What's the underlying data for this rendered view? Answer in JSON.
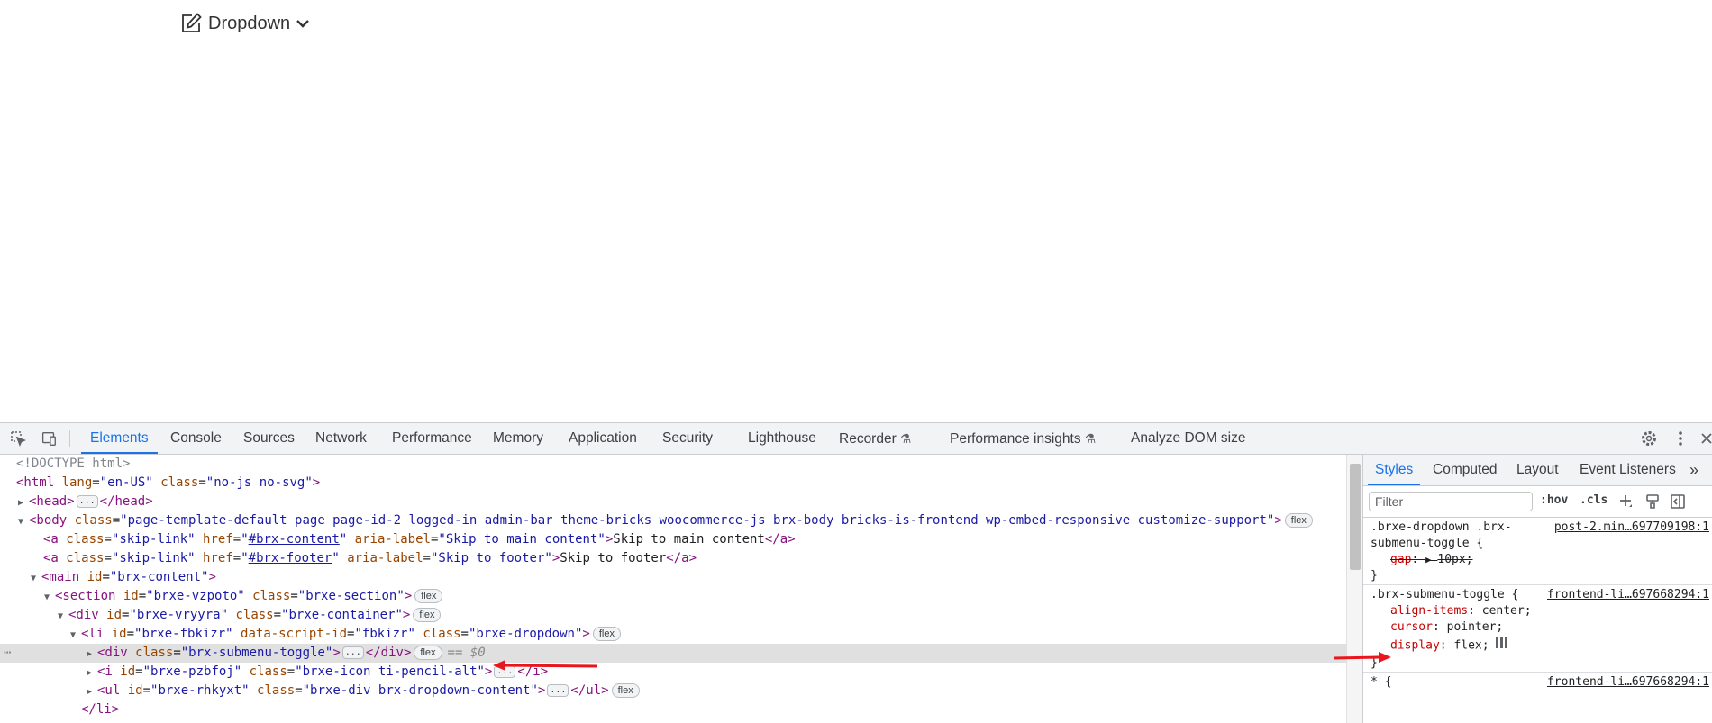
{
  "page": {
    "dropdown_label": "Dropdown"
  },
  "devtools": {
    "tabs": [
      "Elements",
      "Console",
      "Sources",
      "Network",
      "Performance",
      "Memory",
      "Application",
      "Security",
      "Lighthouse",
      "Recorder",
      "Performance insights",
      "Analyze DOM size"
    ],
    "active_tab": "Elements",
    "elements": {
      "selected_marker": "== $0",
      "ellipsis": "...",
      "nodes": {
        "doctype": "<!DOCTYPE html>",
        "html_tag": "<html ",
        "html_lang_attr": "lang",
        "html_lang_val": "\"en-US\"",
        "html_class_attr": "class",
        "html_class_val": "\"no-js no-svg\"",
        "head_open": "<head>",
        "head_close": "</head>",
        "body_tag": "<body ",
        "body_class_attr": "class",
        "body_class_val": "\"page-template-default page page-id-2 logged-in admin-bar theme-bricks woocommerce-js brx-body bricks-is-frontend wp-embed-responsive customize-support\"",
        "a_tag": "<a ",
        "a_close": "</a>",
        "class_attr": "class",
        "href_attr": "href",
        "aria_attr": "aria-label",
        "skip_link_class": "\"skip-link\"",
        "link1_href": "#brx-content",
        "link1_aria": "\"Skip to main content\"",
        "link1_text": "Skip to main content",
        "link2_href": "#brx-footer",
        "link2_aria": "\"Skip to footer\"",
        "link2_text": "Skip to footer",
        "main_tag": "<main ",
        "id_attr": "id",
        "main_id": "\"brx-content\"",
        "section_tag": "<section ",
        "section_id": "\"brxe-vzpoto\"",
        "section_class": "\"brxe-section\"",
        "div_tag": "<div ",
        "div_id": "\"brxe-vryyra\"",
        "div_class": "\"brxe-container\"",
        "li_tag": "<li ",
        "li_id": "\"brxe-fbkizr\"",
        "data_script_attr": "data-script-id",
        "li_script_id": "\"fbkizr\"",
        "li_class": "\"brxe-dropdown\"",
        "toggle_class": "\"brx-submenu-toggle\"",
        "div_close": "</div>",
        "i_tag": "<i ",
        "i_id": "\"brxe-pzbfoj\"",
        "i_class": "\"brxe-icon ti-pencil-alt\"",
        "i_close": "</i>",
        "ul_tag": "<ul ",
        "ul_id": "\"brxe-rhkyxt\"",
        "ul_class": "\"brxe-div brx-dropdown-content\"",
        "ul_close": "</ul>",
        "li_close": "</li>",
        "gt": ">",
        "eq": "="
      },
      "flex_badge": "flex"
    },
    "styles": {
      "tabs": [
        "Styles",
        "Computed",
        "Layout",
        "Event Listeners"
      ],
      "active_tab": "Styles",
      "filter_placeholder": "Filter",
      "hov_label": ":hov",
      "cls_label": ".cls",
      "rules": [
        {
          "selector": ".brxe-dropdown .brx-submenu-toggle {",
          "source": "post-2.min…697709198:1",
          "declarations": [
            {
              "prop": "gap",
              "value": "10px;",
              "overridden": true
            }
          ]
        },
        {
          "selector": ".brx-submenu-toggle {",
          "source": "frontend-li…697668294:1",
          "declarations": [
            {
              "prop": "align-items",
              "value": "center;",
              "overridden": false
            },
            {
              "prop": "cursor",
              "value": "pointer;",
              "overridden": false
            },
            {
              "prop": "display",
              "value": "flex;",
              "overridden": false
            }
          ]
        },
        {
          "selector": "* {",
          "source": "frontend-li…697668294:1",
          "declarations": []
        }
      ],
      "close_brace": "}"
    }
  },
  "colors": {
    "accent": "#1a73e8",
    "annotation_arrow": "#e8171d"
  }
}
